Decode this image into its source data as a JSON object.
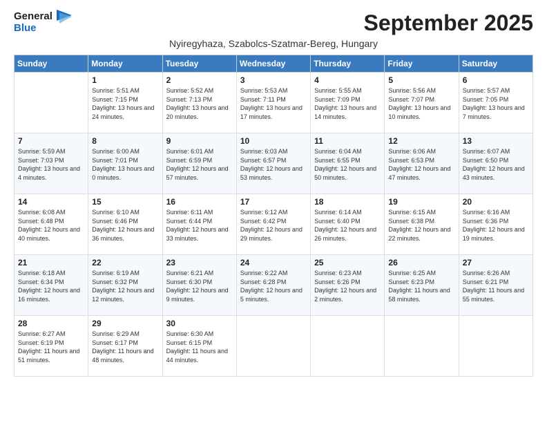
{
  "logo": {
    "general": "General",
    "blue": "Blue"
  },
  "title": "September 2025",
  "subtitle": "Nyiregyhaza, Szabolcs-Szatmar-Bereg, Hungary",
  "weekdays": [
    "Sunday",
    "Monday",
    "Tuesday",
    "Wednesday",
    "Thursday",
    "Friday",
    "Saturday"
  ],
  "weeks": [
    [
      {
        "day": "",
        "info": ""
      },
      {
        "day": "1",
        "info": "Sunrise: 5:51 AM\nSunset: 7:15 PM\nDaylight: 13 hours and 24 minutes."
      },
      {
        "day": "2",
        "info": "Sunrise: 5:52 AM\nSunset: 7:13 PM\nDaylight: 13 hours and 20 minutes."
      },
      {
        "day": "3",
        "info": "Sunrise: 5:53 AM\nSunset: 7:11 PM\nDaylight: 13 hours and 17 minutes."
      },
      {
        "day": "4",
        "info": "Sunrise: 5:55 AM\nSunset: 7:09 PM\nDaylight: 13 hours and 14 minutes."
      },
      {
        "day": "5",
        "info": "Sunrise: 5:56 AM\nSunset: 7:07 PM\nDaylight: 13 hours and 10 minutes."
      },
      {
        "day": "6",
        "info": "Sunrise: 5:57 AM\nSunset: 7:05 PM\nDaylight: 13 hours and 7 minutes."
      }
    ],
    [
      {
        "day": "7",
        "info": "Sunrise: 5:59 AM\nSunset: 7:03 PM\nDaylight: 13 hours and 4 minutes."
      },
      {
        "day": "8",
        "info": "Sunrise: 6:00 AM\nSunset: 7:01 PM\nDaylight: 13 hours and 0 minutes."
      },
      {
        "day": "9",
        "info": "Sunrise: 6:01 AM\nSunset: 6:59 PM\nDaylight: 12 hours and 57 minutes."
      },
      {
        "day": "10",
        "info": "Sunrise: 6:03 AM\nSunset: 6:57 PM\nDaylight: 12 hours and 53 minutes."
      },
      {
        "day": "11",
        "info": "Sunrise: 6:04 AM\nSunset: 6:55 PM\nDaylight: 12 hours and 50 minutes."
      },
      {
        "day": "12",
        "info": "Sunrise: 6:06 AM\nSunset: 6:53 PM\nDaylight: 12 hours and 47 minutes."
      },
      {
        "day": "13",
        "info": "Sunrise: 6:07 AM\nSunset: 6:50 PM\nDaylight: 12 hours and 43 minutes."
      }
    ],
    [
      {
        "day": "14",
        "info": "Sunrise: 6:08 AM\nSunset: 6:48 PM\nDaylight: 12 hours and 40 minutes."
      },
      {
        "day": "15",
        "info": "Sunrise: 6:10 AM\nSunset: 6:46 PM\nDaylight: 12 hours and 36 minutes."
      },
      {
        "day": "16",
        "info": "Sunrise: 6:11 AM\nSunset: 6:44 PM\nDaylight: 12 hours and 33 minutes."
      },
      {
        "day": "17",
        "info": "Sunrise: 6:12 AM\nSunset: 6:42 PM\nDaylight: 12 hours and 29 minutes."
      },
      {
        "day": "18",
        "info": "Sunrise: 6:14 AM\nSunset: 6:40 PM\nDaylight: 12 hours and 26 minutes."
      },
      {
        "day": "19",
        "info": "Sunrise: 6:15 AM\nSunset: 6:38 PM\nDaylight: 12 hours and 22 minutes."
      },
      {
        "day": "20",
        "info": "Sunrise: 6:16 AM\nSunset: 6:36 PM\nDaylight: 12 hours and 19 minutes."
      }
    ],
    [
      {
        "day": "21",
        "info": "Sunrise: 6:18 AM\nSunset: 6:34 PM\nDaylight: 12 hours and 16 minutes."
      },
      {
        "day": "22",
        "info": "Sunrise: 6:19 AM\nSunset: 6:32 PM\nDaylight: 12 hours and 12 minutes."
      },
      {
        "day": "23",
        "info": "Sunrise: 6:21 AM\nSunset: 6:30 PM\nDaylight: 12 hours and 9 minutes."
      },
      {
        "day": "24",
        "info": "Sunrise: 6:22 AM\nSunset: 6:28 PM\nDaylight: 12 hours and 5 minutes."
      },
      {
        "day": "25",
        "info": "Sunrise: 6:23 AM\nSunset: 6:26 PM\nDaylight: 12 hours and 2 minutes."
      },
      {
        "day": "26",
        "info": "Sunrise: 6:25 AM\nSunset: 6:23 PM\nDaylight: 11 hours and 58 minutes."
      },
      {
        "day": "27",
        "info": "Sunrise: 6:26 AM\nSunset: 6:21 PM\nDaylight: 11 hours and 55 minutes."
      }
    ],
    [
      {
        "day": "28",
        "info": "Sunrise: 6:27 AM\nSunset: 6:19 PM\nDaylight: 11 hours and 51 minutes."
      },
      {
        "day": "29",
        "info": "Sunrise: 6:29 AM\nSunset: 6:17 PM\nDaylight: 11 hours and 48 minutes."
      },
      {
        "day": "30",
        "info": "Sunrise: 6:30 AM\nSunset: 6:15 PM\nDaylight: 11 hours and 44 minutes."
      },
      {
        "day": "",
        "info": ""
      },
      {
        "day": "",
        "info": ""
      },
      {
        "day": "",
        "info": ""
      },
      {
        "day": "",
        "info": ""
      }
    ]
  ]
}
